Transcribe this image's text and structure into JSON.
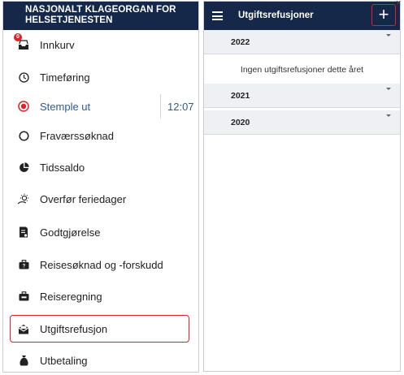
{
  "left": {
    "header_line1": "NASJONALT KLAGEORGAN FOR",
    "header_line2": "HELSETJENESTEN",
    "inbox_badge": "0",
    "items": [
      {
        "label": "Innkurv",
        "icon": "inbox-icon"
      },
      {
        "label": "Timeføring",
        "icon": "clock-icon"
      },
      {
        "label": "Stemple ut",
        "icon": "stop-record-icon",
        "time": "12:07"
      },
      {
        "label": "Fraværssøknad",
        "icon": "circle-icon"
      },
      {
        "label": "Tidssaldo",
        "icon": "pie-chart-icon"
      },
      {
        "label": "Overfør feriedager",
        "icon": "sun-icon"
      },
      {
        "label": "Godtgjørelse",
        "icon": "receipt-icon"
      },
      {
        "label": "Reisesøknad og -forskudd",
        "icon": "briefcase-icon"
      },
      {
        "label": "Reiseregning",
        "icon": "suitcase-icon"
      },
      {
        "label": "Utgiftsrefusjon",
        "icon": "envelope-open-icon"
      },
      {
        "label": "Utbetaling",
        "icon": "money-bag-icon"
      }
    ]
  },
  "right": {
    "title": "Utgiftsrefusjoner",
    "add_label": "+",
    "years": [
      "2022",
      "2021",
      "2020"
    ],
    "empty_text": "Ingen utgiftsrefusjoner dette året"
  },
  "close_label": "×",
  "colors": {
    "header": "#15284a",
    "accent": "#2d5a9b",
    "highlight": "#e0202a"
  }
}
